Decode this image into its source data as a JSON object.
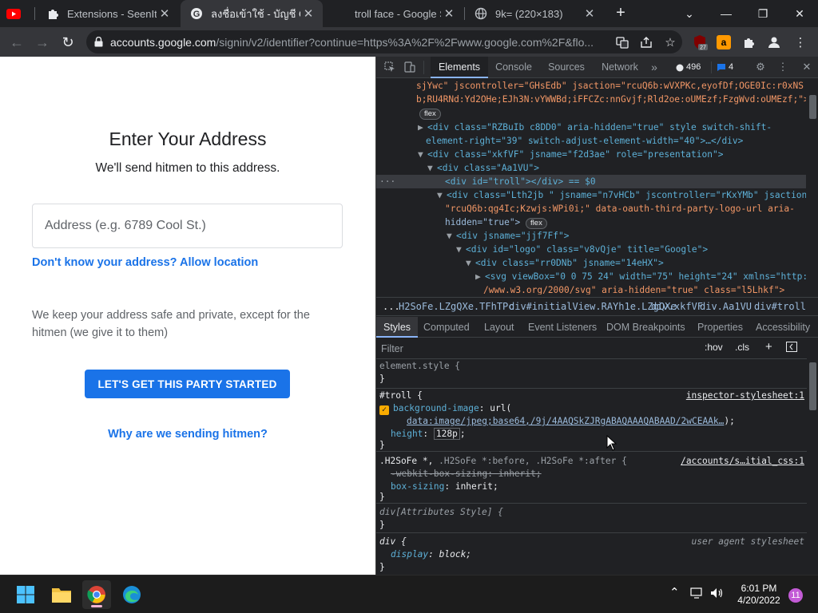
{
  "browser": {
    "tabs": [
      {
        "title": "Extensions - SeenIt",
        "active": false
      },
      {
        "title": "ลงชื่อเข้าใช้ - บัญชี Goo",
        "active": true
      },
      {
        "title": "troll face - Google Se",
        "active": false
      },
      {
        "title": "9k= (220×183)",
        "active": false
      }
    ],
    "new_tab": "+",
    "url_host": "accounts.google.com",
    "url_rest": "/signin/v2/identifier?continue=https%3A%2F%2Fwww.google.com%2F&flo...",
    "ext_badge": "27"
  },
  "page": {
    "heading": "Enter Your Address",
    "subheading": "We'll send hitmen to this address.",
    "address_placeholder": "Address (e.g. 6789 Cool St.)",
    "location_link": "Don't know your address? Allow location",
    "privacy_text": "We keep your address safe and private, except for the hitmen (we give it to them)",
    "cta_label": "LET'S GET THIS PARTY STARTED",
    "why_link": "Why are we sending hitmen?",
    "colors": {
      "accent": "#1a73e8"
    }
  },
  "devtools": {
    "tabs": [
      "Elements",
      "Console",
      "Sources",
      "Network"
    ],
    "more": "»",
    "warnings_count": "496",
    "messages_count": "4",
    "dom_lines": [
      {
        "t": "sjYwc\" jscontroller=\"GHsEdb\" jsaction=\"rcuQ6b:wVXPKc,eyofDf;OGE0Ic:r0xNS"
      },
      {
        "t": "b;RU4RNd:Yd2OHe;EJh3N:vYWWBd;iFFCZc:nnGvjf;Rld2oe:oUMEzf;FzgWvd:oUMEzf;\">"
      },
      {
        "t": "flex"
      },
      {
        "t": "<div class=\"RZBuIb c8DD0\" aria-hidden=\"true\" style switch-shift-"
      },
      {
        "t": "element-right=\"39\" switch-adjust-element-width=\"40\">…</div>"
      },
      {
        "t": "<div class=\"xkfVF\" jsname=\"f2d3ae\" role=\"presentation\">"
      },
      {
        "t": "<div class=\"Aa1VU\">"
      },
      {
        "t": "<div id=\"troll\"></div> == $0"
      },
      {
        "t": "<div class=\"Lth2jb \" jsname=\"n7vHCb\" jscontroller=\"rKxYMb\" jsaction="
      },
      {
        "t": "\"rcuQ6b:qg4Ic;Kzwjs:WPi0i;\" data-oauth-third-party-logo-url aria-"
      },
      {
        "t": "hidden=\"true\">"
      },
      {
        "t": "<div jsname=\"jjf7Ff\">"
      },
      {
        "t": "<div id=\"logo\" class=\"v8vQje\" title=\"Google\">"
      },
      {
        "t": "<div class=\"rr0DNb\" jsname=\"14eHX\">"
      },
      {
        "t": "<svg viewBox=\"0 0 75 24\" width=\"75\" height=\"24\" xmlns=\"http:/"
      },
      {
        "t": "/www.w3.org/2000/svg\" aria-hidden=\"true\" class=\"l5Lhkf\">"
      }
    ],
    "flex_pill": "flex",
    "breadcrumbs": [
      "...",
      "H2SoFe.LZgQXe.TFhTPc",
      "div#initialView.RAYh1e.LZgQXe",
      "div.xkfVF",
      "div.Aa1VU",
      "div#troll"
    ],
    "sub_tabs": [
      "Styles",
      "Computed",
      "Layout",
      "Event Listeners",
      "DOM Breakpoints",
      "Properties",
      "Accessibility"
    ],
    "filter_placeholder": "Filter",
    "hov": ":hov",
    "cls": ".cls",
    "rules": {
      "element_style": "element.style {",
      "troll_selector": "#troll {",
      "troll_source": "inspector-stylesheet:1",
      "bg_prop": "background-image",
      "bg_prefix": ": url(",
      "bg_url": "data:image/jpeg;base64,/9j/4AAQSkZJRgABAQAAAQABAAD/2wCEAAk…",
      "bg_suffix": ");",
      "height_prop": "height",
      "height_val": "128p",
      "h2_selector_main": ".H2SoFe *,",
      "h2_selector_dim": " .H2SoFe *:before, .H2SoFe *:after {",
      "h2_source": "/accounts/s…itial_css:1",
      "webkit_prop": "-webkit-box-sizing",
      "webkit_val": ": inherit;",
      "box_prop": "box-sizing",
      "box_val": ": inherit;",
      "attr_selector": "div[Attributes Style] {",
      "div_selector": "div {",
      "div_source": "user agent stylesheet",
      "display_prop": "display",
      "display_val": ": block;",
      "close": "}"
    }
  },
  "taskbar": {
    "time": "6:01 PM",
    "date": "4/20/2022",
    "notifications": "11"
  }
}
